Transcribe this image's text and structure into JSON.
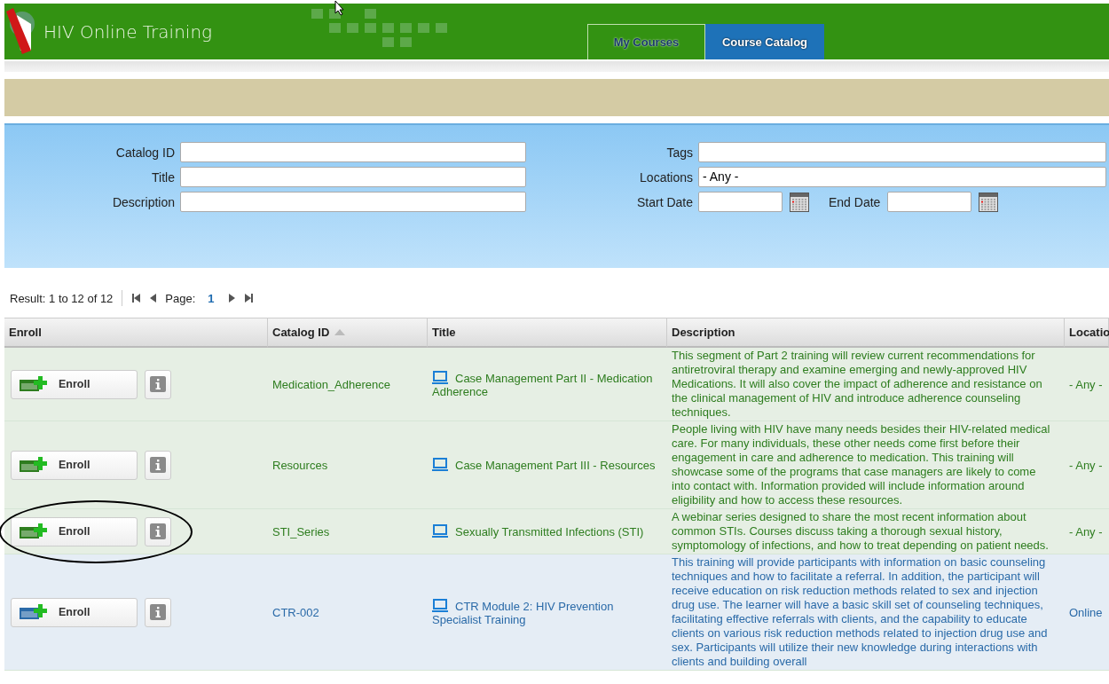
{
  "header": {
    "title": "HIV Online Training",
    "tabs": [
      {
        "label": "My Courses",
        "selected": false
      },
      {
        "label": "Course Catalog",
        "selected": true
      }
    ]
  },
  "search": {
    "fields": [
      {
        "label": "Catalog ID",
        "kind": "text"
      },
      {
        "label": "Title",
        "kind": "text"
      },
      {
        "label": "Description",
        "kind": "text"
      }
    ],
    "right_fields": [
      {
        "label": "Tags",
        "kind": "text"
      },
      {
        "label": "Locations",
        "kind": "select",
        "value": "- Any -"
      }
    ],
    "dates": [
      {
        "label": "Start Date"
      },
      {
        "label": "End Date"
      }
    ]
  },
  "pager": {
    "result": "Result: 1 to 12 of 12",
    "page_label": "Page:",
    "page": "1"
  },
  "table": {
    "columns": [
      {
        "label": "Enroll",
        "sorted": false
      },
      {
        "label": "Catalog ID",
        "sorted": true
      },
      {
        "label": "Title",
        "sorted": false
      },
      {
        "label": "Description",
        "sorted": false
      },
      {
        "label": "Locatio",
        "sorted": false
      }
    ],
    "rows": [
      {
        "enroll": "Enroll",
        "catalog_id": "Medication_Adherence",
        "title": "Case Management Part II - Medication Adherence",
        "description": "This segment of Part 2 training will review current recommendations for antiretroviral therapy and examine emerging and newly-approved HIV Medications. It will also cover the impact of adherence and resistance on the clinical management of HIV and introduce adherence counseling techniques.",
        "location": "- Any -",
        "color": "#2e7d1f",
        "circled": false
      },
      {
        "enroll": "Enroll",
        "catalog_id": "Resources",
        "title": "Case Management Part III - Resources",
        "description": "People living with HIV have many needs besides their HIV-related medical care. For many individuals, these other needs come first before their engagement in care and adherence to medication. This training will showcase some of the programs that case managers are likely to come into contact with. Information provided will include information around eligibility and how to access these resources.",
        "location": "- Any -",
        "color": "#2e7d1f",
        "circled": false
      },
      {
        "enroll": "Enroll",
        "catalog_id": "STI_Series",
        "title": "Sexually Transmitted Infections (STI)",
        "description": "A webinar series designed to share the most recent information about common STIs. Courses discuss taking a thorough sexual history, symptomology of infections, and how to treat depending on patient needs.",
        "location": "- Any -",
        "color": "#2e7d1f",
        "circled": true
      },
      {
        "enroll": "Enroll",
        "catalog_id": "CTR-002",
        "title": "CTR Module 2: HIV Prevention Specialist Training",
        "description": "This training will provide participants with information on basic counseling techniques and how to facilitate a referral. In addition, the participant will receive education on risk reduction methods related to sex and injection drug use. The learner will have a basic skill set of counseling techniques, facilitating effective referrals with clients, and the capability to educate clients on various risk reduction methods related to injection drug use and sex. Participants will utilize their new knowledge during interactions with clients and building overall",
        "location": "Online",
        "color": "#2a6aa8",
        "circled": false
      }
    ]
  }
}
